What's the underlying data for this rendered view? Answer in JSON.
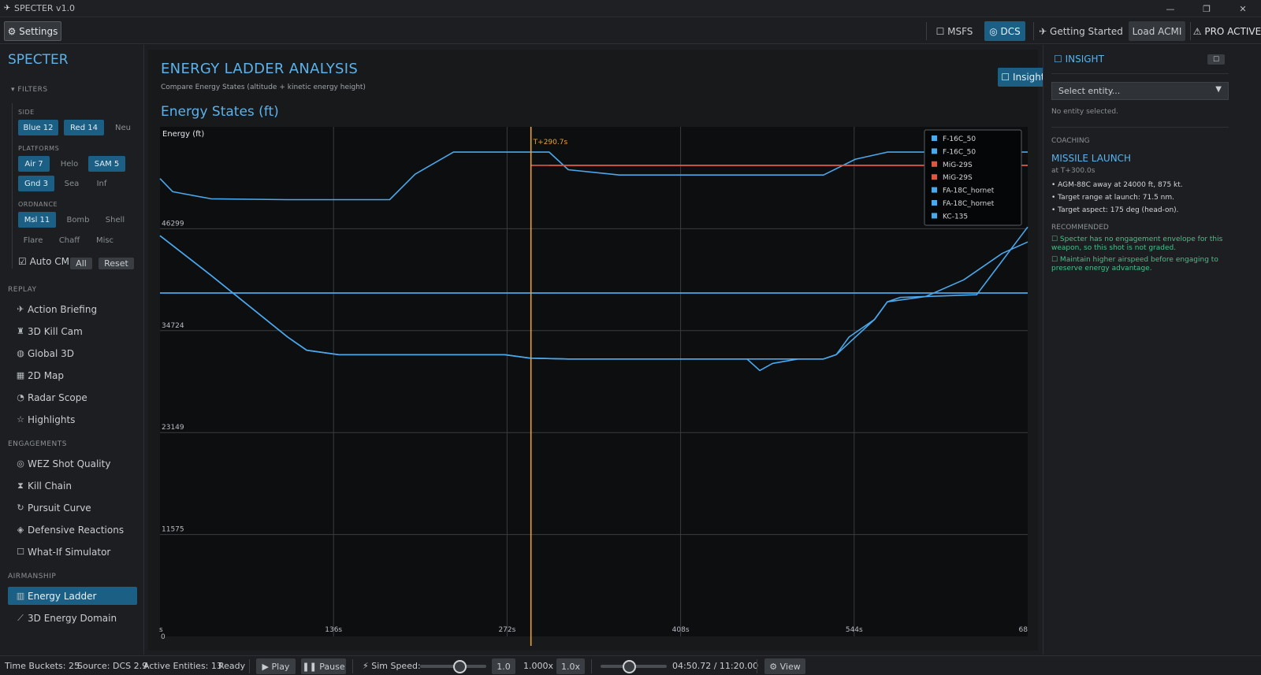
{
  "window": {
    "title": "SPECTER v1.0"
  },
  "toolbar": {
    "settings": "⚙ Settings",
    "msfs": "☐ MSFS",
    "dcs": "◎ DCS",
    "getting_started": "✈ Getting Started",
    "load_acmi": "Load ACMI",
    "pro_active": "⚠ PRO ACTIVE"
  },
  "sidebar": {
    "brand": "SPECTER",
    "filters_label": "▾  FILTERS",
    "side_label": "SIDE",
    "side": [
      {
        "label": "Blue  12",
        "on": true
      },
      {
        "label": "Red  14",
        "on": true
      },
      {
        "label": "Neu",
        "on": false
      }
    ],
    "platforms_label": "PLATFORMS",
    "platforms": [
      {
        "label": "Air  7",
        "on": true
      },
      {
        "label": "Helo",
        "on": false
      },
      {
        "label": "SAM  5",
        "on": true
      },
      {
        "label": "Gnd  3",
        "on": true
      },
      {
        "label": "Sea",
        "on": false
      },
      {
        "label": "Inf",
        "on": false
      }
    ],
    "ordnance_label": "ORDNANCE",
    "ordnance": [
      {
        "label": "Msl  11",
        "on": true
      },
      {
        "label": "Bomb",
        "on": false
      },
      {
        "label": "Shell",
        "on": false
      },
      {
        "label": "Flare",
        "on": false
      },
      {
        "label": "Chaff",
        "on": false
      },
      {
        "label": "Misc",
        "on": false
      }
    ],
    "auto_cm": "☑ Auto CM",
    "all": "All",
    "reset": "Reset",
    "replay_label": "REPLAY",
    "replay": [
      {
        "icon": "✈",
        "label": "Action Briefing"
      },
      {
        "icon": "♜",
        "label": "3D Kill Cam"
      },
      {
        "icon": "◍",
        "label": "Global 3D"
      },
      {
        "icon": "▦",
        "label": "2D Map"
      },
      {
        "icon": "◔",
        "label": "Radar Scope"
      },
      {
        "icon": "☆",
        "label": "Highlights"
      }
    ],
    "engagements_label": "ENGAGEMENTS",
    "engagements": [
      {
        "icon": "◎",
        "label": "WEZ Shot Quality"
      },
      {
        "icon": "⧗",
        "label": "Kill Chain"
      },
      {
        "icon": "↻",
        "label": "Pursuit Curve"
      },
      {
        "icon": "◈",
        "label": "Defensive Reactions"
      },
      {
        "icon": "☐",
        "label": "What-If Simulator"
      }
    ],
    "airmanship_label": "AIRMANSHIP",
    "airmanship": [
      {
        "icon": "▥",
        "label": "Energy Ladder"
      },
      {
        "icon": "⟋",
        "label": "3D Energy Domain"
      }
    ]
  },
  "main": {
    "title": "ENERGY LADDER ANALYSIS",
    "subtitle": "Compare Energy States (altitude + kinetic energy height)",
    "insight_button": "☐ Insight",
    "chart_title": "Energy States (ft)"
  },
  "chart_data": {
    "type": "line",
    "ylabel": "Energy (ft)",
    "y_ticks": [
      "46299",
      "34724",
      "23149",
      "11575"
    ],
    "x_ticks": [
      "s\n0",
      "136s",
      "272s",
      "408s",
      "544s",
      "68"
    ],
    "xlim": [
      0,
      680
    ],
    "ylim": [
      0,
      57874
    ],
    "cursor": {
      "x": 290.7,
      "label": "T+290.7s"
    },
    "series": [
      {
        "name": "F-16C_50",
        "color": "#4aa8ec",
        "x": [
          0,
          10,
          40,
          100,
          180,
          200,
          230,
          290,
          305,
          320,
          360,
          520,
          545,
          570,
          600,
          680
        ],
        "y": [
          52000,
          50500,
          49700,
          49600,
          49600,
          52500,
          55000,
          55000,
          55000,
          53000,
          52400,
          52400,
          54200,
          55000,
          55000,
          55000
        ]
      },
      {
        "name": "F-16C_50",
        "color": "#4aa8ec",
        "x": [
          0,
          680
        ],
        "y": [
          39000,
          39000
        ]
      },
      {
        "name": "MiG-29S",
        "color": "#e05540",
        "x": [
          290.7,
          680
        ],
        "y": [
          53500,
          53500
        ]
      },
      {
        "name": "MiG-29S",
        "color": "#e05540",
        "x": [
          305,
          680
        ],
        "y": [
          53500,
          53500
        ]
      },
      {
        "name": "FA-18C_hornet",
        "color": "#4aa8ec",
        "x": [
          0,
          40,
          100,
          115,
          140,
          200,
          270,
          290,
          320,
          400,
          430,
          460,
          470,
          480,
          500,
          520,
          530,
          560,
          570,
          580,
          640,
          680
        ],
        "y": [
          45500,
          41000,
          34000,
          32500,
          32000,
          32000,
          32000,
          31600,
          31500,
          31500,
          31500,
          31500,
          30200,
          31000,
          31500,
          31500,
          32000,
          36000,
          38000,
          38500,
          38800,
          46500
        ]
      },
      {
        "name": "FA-18C_hornet",
        "color": "#4aa8ec",
        "x": [
          0,
          40,
          100,
          115,
          140,
          200,
          270,
          290,
          320,
          400,
          430,
          460,
          470,
          480,
          500,
          520,
          530,
          540,
          560,
          570,
          600,
          630,
          660,
          680
        ],
        "y": [
          45500,
          41000,
          34000,
          32500,
          32000,
          32000,
          32000,
          31600,
          31500,
          31500,
          31500,
          31500,
          31500,
          31500,
          31500,
          31500,
          32000,
          34000,
          36000,
          38000,
          38600,
          40500,
          43500,
          44800
        ]
      },
      {
        "name": "KC-135",
        "color": "#4aa8ec",
        "x": [
          0,
          680
        ],
        "y": [
          39000,
          39000
        ]
      }
    ]
  },
  "insight": {
    "title": "☐ INSIGHT",
    "select_placeholder": "Select entity...",
    "no_entity": "No entity selected.",
    "coaching_label": "COACHING",
    "event_title": "MISSILE LAUNCH",
    "event_time": "at T+300.0s",
    "bullets": [
      "• AGM-88C away at 24000 ft, 875 kt.",
      "• Target range at launch: 71.5 nm.",
      "• Target aspect: 175 deg (head-on)."
    ],
    "recommended_label": "RECOMMENDED",
    "recommendations": [
      "☐ Specter has no engagement envelope for this weapon, so this shot is not graded.",
      "☐ Maintain higher airspeed before engaging to preserve energy advantage."
    ]
  },
  "status": {
    "buckets": "Time Buckets: 25",
    "source": "Source: DCS 2.9",
    "entities": "Active Entities: 13",
    "ready": "Ready",
    "play": "▶ Play",
    "pause": "❚❚ Pause",
    "sim_speed": "⚡ Sim Speed:",
    "speed_value": "1.0",
    "speed_factor": "1.000x",
    "speed_btn": "1.0x",
    "time": "04:50.72 / 11:20.00",
    "view": "⚙ View",
    "sim_speed_fraction": 0.6,
    "time_fraction": 0.43
  }
}
